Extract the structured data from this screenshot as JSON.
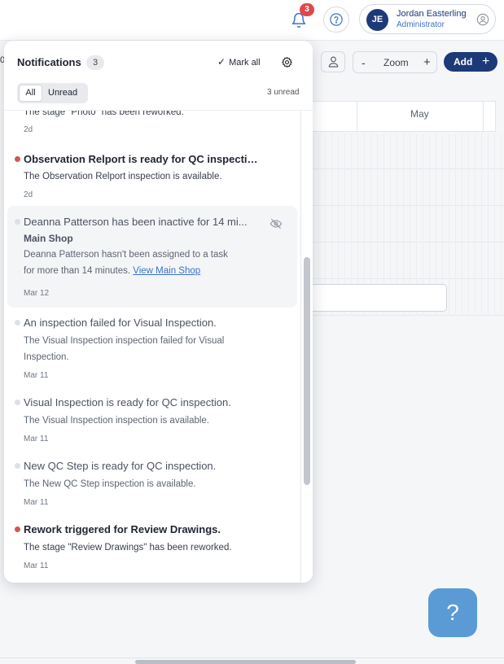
{
  "header": {
    "notification_badge": "3",
    "user": {
      "initials": "JE",
      "name": "Jordan Easterling",
      "role": "Administrator"
    }
  },
  "toolbar": {
    "zoom_minus": "-",
    "zoom_label": "Zoom",
    "zoom_plus": "+",
    "add_label": "Add",
    "add_plus": "+"
  },
  "board": {
    "month": "May",
    "left_fragment": "0"
  },
  "help_fab_label": "?",
  "notifications": {
    "title": "Notifications",
    "count": "3",
    "mark_all_label": "Mark all",
    "filter_all": "All",
    "filter_unread": "Unread",
    "unread_summary": "3 unread",
    "items": [
      {
        "body": "The stage \"Photo\" has been reworked.",
        "time": "2d"
      },
      {
        "title": "Observation Relport is ready for QC inspectio...",
        "body": "The Observation Relport inspection is available.",
        "time": "2d",
        "unread": true
      },
      {
        "title": "Deanna Patterson has been inactive for 14 mi...",
        "subtitle": "Main Shop",
        "body_line1": "Deanna Patterson hasn't been assigned to a task",
        "body_line2": "for more than 14 minutes.",
        "link": "View Main Shop",
        "time": "Mar 12",
        "unread": false
      },
      {
        "title": "An inspection failed for Visual Inspection.",
        "body_line1": "The Visual Inspection inspection failed for Visual",
        "body_line2": "Inspection.",
        "time": "Mar 11",
        "unread": false
      },
      {
        "title": "Visual Inspection is ready for QC inspection.",
        "body": "The Visual Inspection inspection is available.",
        "time": "Mar 11",
        "unread": false
      },
      {
        "title": "New QC Step is ready for QC inspection.",
        "body": "The New QC Step inspection is available.",
        "time": "Mar 11",
        "unread": false
      },
      {
        "title": "Rework triggered for Review Drawings.",
        "body": "The stage \"Review Drawings\" has been reworked.",
        "time": "Mar 11",
        "unread": true
      }
    ]
  },
  "colors": {
    "brand": "#1d3a78",
    "accent": "#3b73c8",
    "unread_dot": "#d9534f",
    "badge": "#e0474c",
    "fab": "#5a9bd5"
  },
  "icons": [
    "bell-icon",
    "help-circle-icon",
    "user-circle-icon",
    "person-icon",
    "gear-icon",
    "checkmark-icon",
    "eye-off-icon"
  ]
}
